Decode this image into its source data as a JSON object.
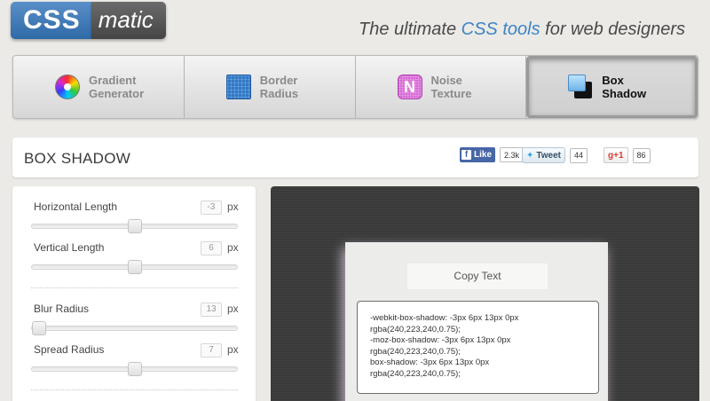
{
  "header": {
    "logo_left": "CSS",
    "logo_right": "matic",
    "tagline_pre": "The ultimate ",
    "tagline_accent": "CSS tools",
    "tagline_post": " for web designers"
  },
  "tabs": [
    {
      "line1": "Gradient",
      "line2": "Generator",
      "icon": "gradient-wheel-icon",
      "active": false
    },
    {
      "line1": "Border",
      "line2": "Radius",
      "icon": "border-radius-icon",
      "active": false
    },
    {
      "line1": "Noise",
      "line2": "Texture",
      "icon": "noise-texture-icon",
      "active": false
    },
    {
      "line1": "Box",
      "line2": "Shadow",
      "icon": "box-shadow-icon",
      "active": true
    }
  ],
  "title_bar": {
    "title": "BOX SHADOW",
    "facebook": {
      "label": "Like",
      "count": "2.3k"
    },
    "twitter": {
      "label": "Tweet",
      "count": "44"
    },
    "gplus": {
      "label": "+1",
      "count": "86"
    }
  },
  "controls": [
    {
      "label": "Horizontal Length",
      "value": "-3",
      "unit": "px",
      "slider_fraction": 0.5
    },
    {
      "label": "Vertical Length",
      "value": "6",
      "unit": "px",
      "slider_fraction": 0.5
    },
    {
      "label": "Blur Radius",
      "value": "13",
      "unit": "px",
      "slider_fraction": 0.0
    },
    {
      "label": "Spread Radius",
      "value": "7",
      "unit": "px",
      "slider_fraction": 0.5
    }
  ],
  "preview": {
    "copy_label": "Copy Text",
    "code_lines": [
      "-webkit-box-shadow: -3px 6px 13px 0px",
      "rgba(240,223,240,0.75);",
      "-moz-box-shadow: -3px 6px 13px 0px",
      "rgba(240,223,240,0.75);",
      "box-shadow: -3px 6px 13px 0px",
      "rgba(240,223,240,0.75);"
    ]
  },
  "colors": {
    "accent": "#3d83c4",
    "preview_bg": "#3b3b3b"
  }
}
